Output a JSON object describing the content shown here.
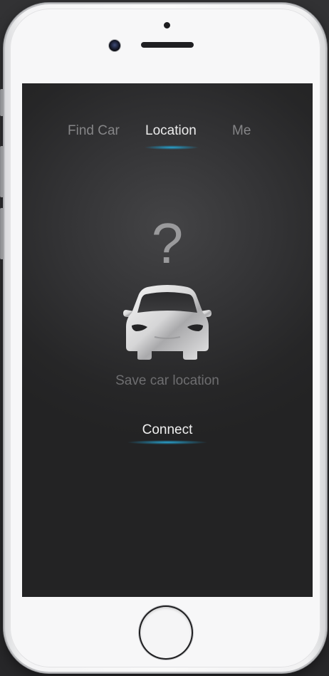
{
  "tabs": [
    {
      "label": "Find Car",
      "active": false
    },
    {
      "label": "Location",
      "active": true
    },
    {
      "label": "Me",
      "active": false
    }
  ],
  "main": {
    "question_mark": "?",
    "car_icon": "car-front-icon",
    "status_text": "Save car location",
    "connect_label": "Connect"
  },
  "colors": {
    "accent": "#2aa6d2",
    "screen_bg": "#2a2a2b",
    "active_tab": "#ececec",
    "inactive_tab": "#858587"
  }
}
